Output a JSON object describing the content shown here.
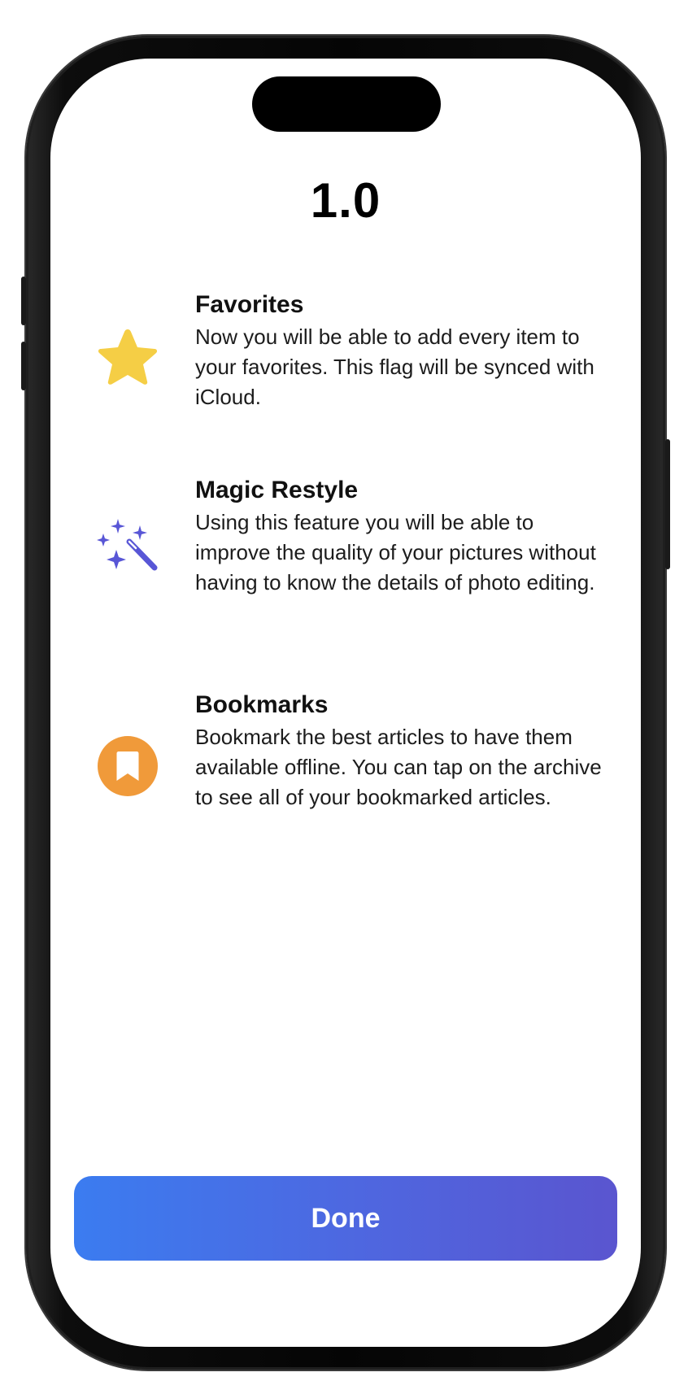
{
  "header": {
    "version": "1.0"
  },
  "features": [
    {
      "title": "Favorites",
      "description": "Now you will be able to add every item to your favorites. This flag will be synced with iCloud.",
      "icon": "star-icon",
      "color": "#F5CE45"
    },
    {
      "title": "Magic Restyle",
      "description": "Using this feature you will be able to improve the quality of your pictures without having to know the details of photo editing.",
      "icon": "magic-wand-icon",
      "color": "#5856D6"
    },
    {
      "title": "Bookmarks",
      "description": "Bookmark the best articles to have them available offline. You can tap on the archive to see all of your bookmarked articles.",
      "icon": "bookmark-icon",
      "color": "#F09A3A"
    }
  ],
  "footer": {
    "done_label": "Done",
    "gradient_start": "#3B7CF0",
    "gradient_end": "#5A55CF"
  }
}
